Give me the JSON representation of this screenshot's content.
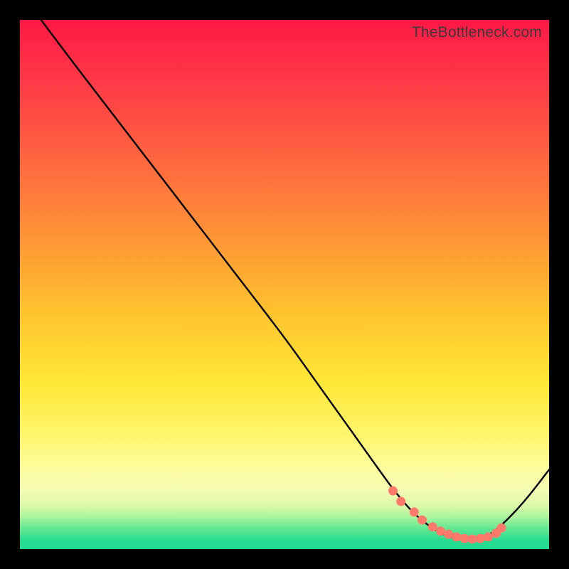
{
  "watermark": "TheBottleneck.com",
  "chart_data": {
    "type": "line",
    "title": "",
    "xlabel": "",
    "ylabel": "",
    "xlim": [
      0,
      100
    ],
    "ylim": [
      0,
      100
    ],
    "grid": false,
    "legend": false,
    "series": [
      {
        "name": "curve",
        "x": [
          4,
          10,
          20,
          30,
          40,
          50,
          55,
          60,
          65,
          70,
          72,
          74,
          76,
          78,
          80,
          82,
          84,
          86,
          88,
          90,
          95,
          100
        ],
        "y": [
          100,
          92,
          79,
          66,
          53,
          40,
          33,
          26,
          19,
          12,
          9.5,
          7.2,
          5.4,
          3.9,
          2.8,
          2.1,
          1.8,
          1.9,
          2.4,
          3.5,
          8.5,
          15
        ]
      }
    ],
    "markers": {
      "name": "highlight-dots",
      "color": "#ff7a6b",
      "x": [
        70.5,
        72,
        74.5,
        76,
        78,
        79.5,
        81,
        82.5,
        84,
        85.5,
        87,
        88.5,
        90,
        91
      ],
      "y": [
        11,
        9,
        7,
        5.5,
        4.2,
        3.4,
        2.8,
        2.3,
        2.0,
        1.9,
        2.0,
        2.3,
        3.0,
        4.0
      ]
    }
  }
}
